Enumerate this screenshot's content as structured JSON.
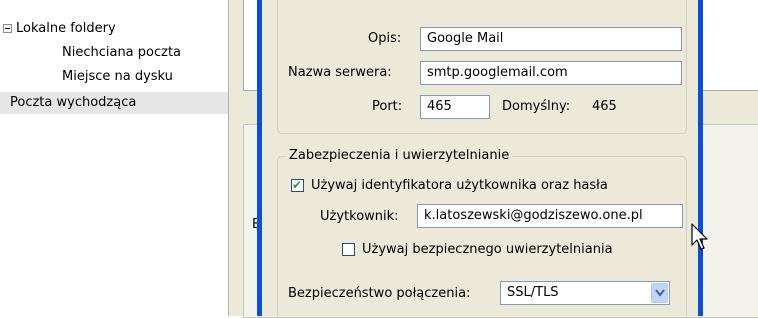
{
  "tree": {
    "items": [
      {
        "label": "Lokalne foldery"
      },
      {
        "label": "Niechciana poczta"
      },
      {
        "label": "Miejsce na dysku"
      },
      {
        "label": "Poczta wychodząca"
      }
    ]
  },
  "background": {
    "partial_label": "E"
  },
  "server": {
    "description_label": "Opis:",
    "description_value": "Google Mail",
    "server_name_label": "Nazwa serwera:",
    "server_name_value": "smtp.googlemail.com",
    "port_label": "Port:",
    "port_value": "465",
    "default_label": "Domyślny:",
    "default_value": "465"
  },
  "security": {
    "group_title": "Zabezpieczenia i uwierzytelnianie",
    "use_credentials_label": "Używaj identyfikatora użytkownika oraz hasła",
    "use_credentials_checked": true,
    "username_label": "Użytkownik:",
    "username_value": "k.latoszewski@godziszewo.one.pl",
    "secure_auth_label": "Używaj bezpiecznego uwierzytelniania",
    "secure_auth_checked": false,
    "connection_security_label": "Bezpieczeństwo połączenia:",
    "connection_security_value": "SSL/TLS"
  },
  "colors": {
    "dialog_border": "#0a4fd8",
    "window_bg": "#ece9d8",
    "field_border": "#7f9db9",
    "checkmark": "#21a121",
    "selected_row": "#e6e6e6"
  }
}
